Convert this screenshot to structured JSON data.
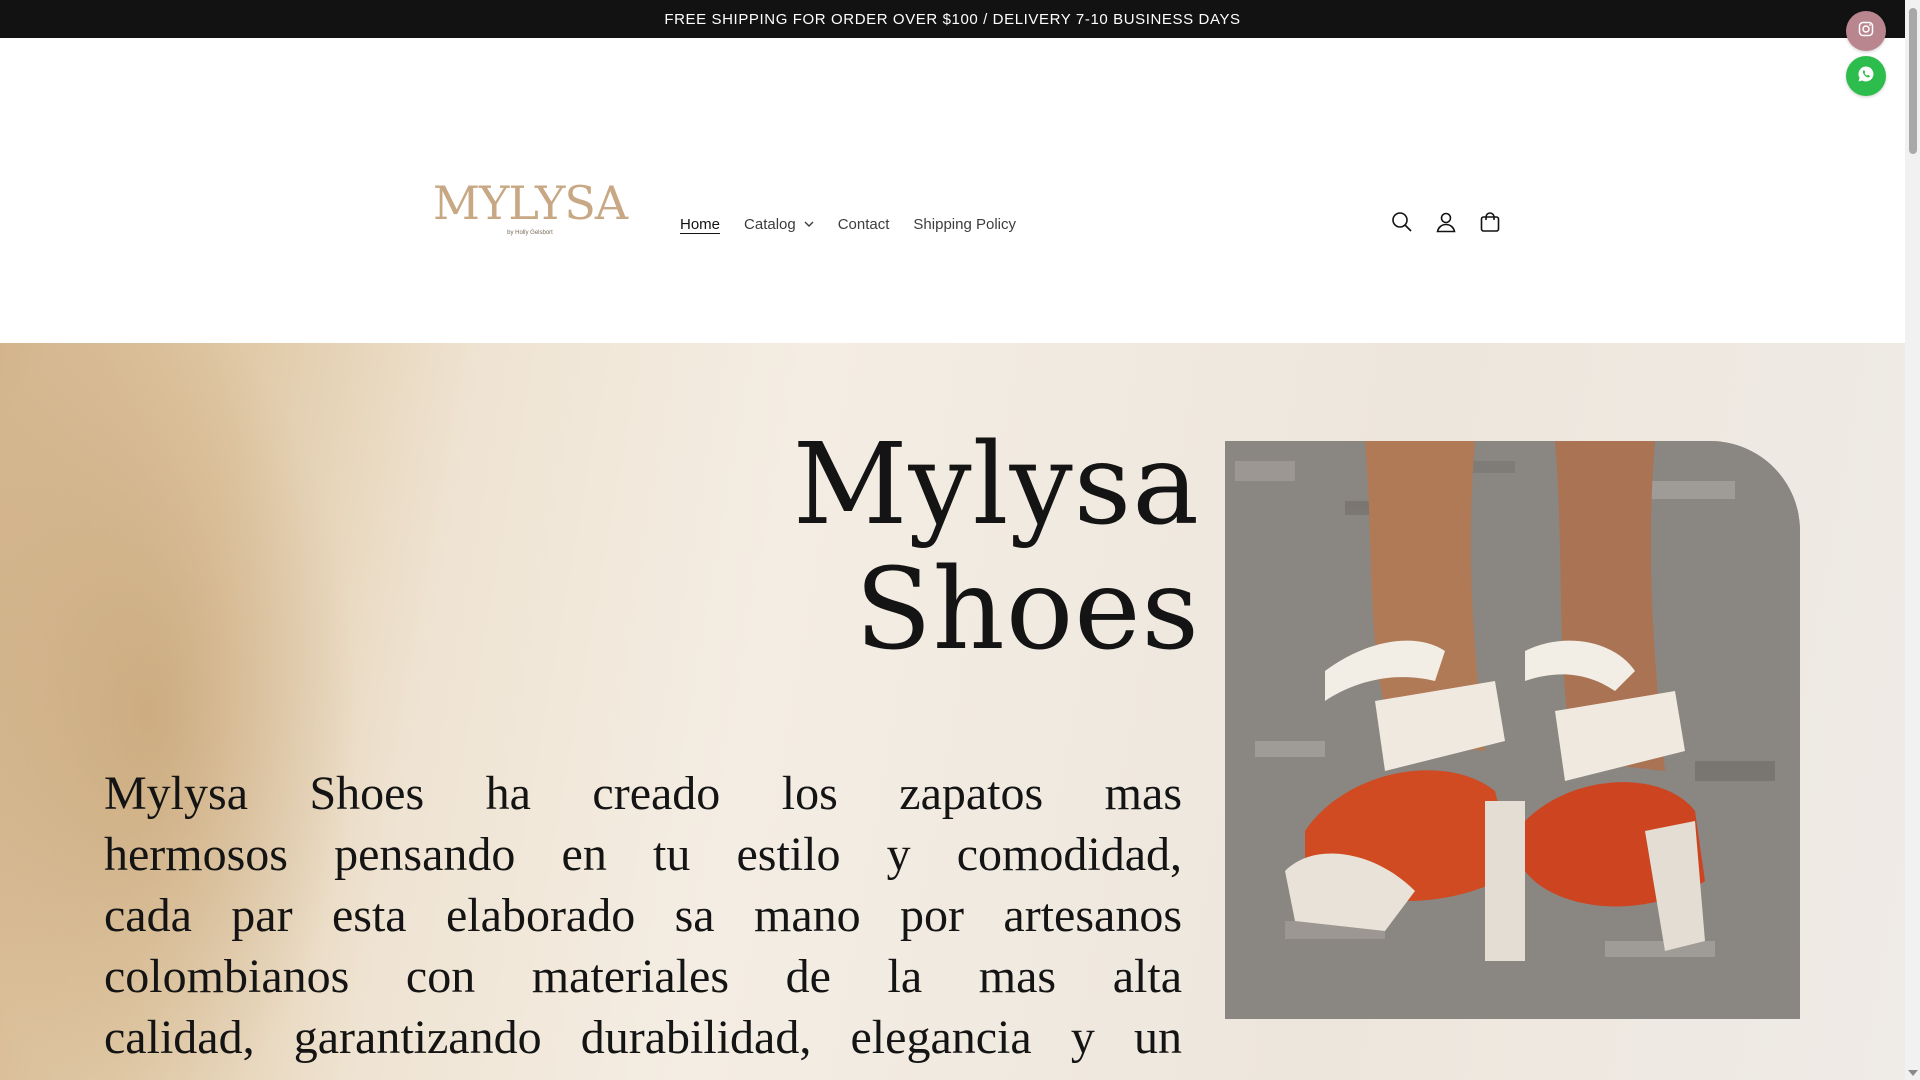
{
  "announcement": {
    "text": "FREE SHIPPING FOR ORDER OVER $100 / DELIVERY 7-10 BUSINESS DAYS"
  },
  "logo": {
    "text": "MYLYSA",
    "subtext": "by Holly Gelsbort"
  },
  "nav": {
    "items": [
      {
        "label": "Home",
        "active": true
      },
      {
        "label": "Catalog",
        "has_dropdown": true
      },
      {
        "label": "Contact"
      },
      {
        "label": "Shipping Policy"
      }
    ]
  },
  "header_icons": [
    "search-icon",
    "account-icon",
    "cart-icon"
  ],
  "floating": [
    "instagram-icon",
    "whatsapp-icon"
  ],
  "hero": {
    "title_line1": "Mylysa",
    "title_line2": "Shoes",
    "text_lines": [
      "Mylysa  Shoes  ha  creado  los  zapatos  mas",
      "hermosos  pensando en tu estilo  y comodidad,",
      "cada par esta elaborado sa mano por artesanos",
      "colombianos  con  materiales  de  la  mas  alta",
      "calidad, garantizando durabilidad, elegancia y un"
    ]
  },
  "colors": {
    "announcement_bg": "#121212",
    "logo": "#c8a884",
    "instagram_bg": "#b9868f",
    "whatsapp_bg": "#2dbd4c"
  }
}
